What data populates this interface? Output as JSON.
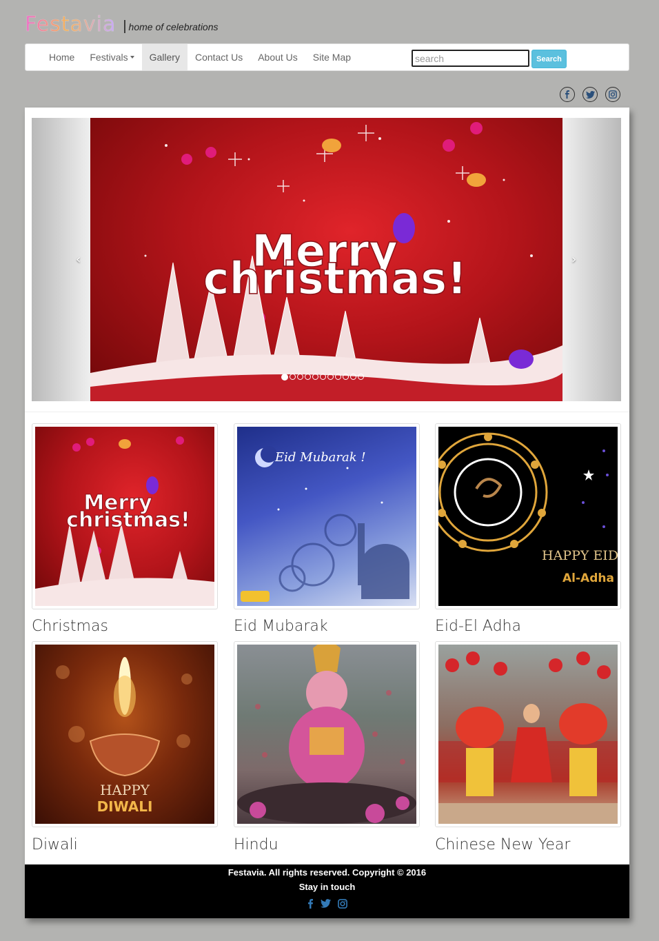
{
  "brand": {
    "logo": "Festavia",
    "separator": "|",
    "tagline": "home of celebrations"
  },
  "nav": {
    "items": [
      {
        "label": "Home"
      },
      {
        "label": "Festivals",
        "has_dropdown": true
      },
      {
        "label": "Gallery",
        "active": true
      },
      {
        "label": "Contact Us"
      },
      {
        "label": "About Us"
      },
      {
        "label": "Site Map"
      }
    ],
    "search_placeholder": "search",
    "search_button": "Search"
  },
  "social": [
    "facebook-icon",
    "twitter-icon",
    "instagram-icon"
  ],
  "carousel": {
    "prev": "‹",
    "next": "›",
    "slide_text_line1": "Merry",
    "slide_text_line2": "christmas!",
    "indicator_count": 11,
    "active_indicator": 0
  },
  "gallery": [
    {
      "caption": "Christmas",
      "art_line1": "Merry",
      "art_line2": "christmas!"
    },
    {
      "caption": "Eid Mubarak",
      "art_line1": "Eid Mubarak !"
    },
    {
      "caption": "Eid-El Adha",
      "art_line1": "HAPPY EID",
      "art_line2": "Al-Adha"
    },
    {
      "caption": "Diwali",
      "art_line1": "HAPPY",
      "art_line2": "DIWALI"
    },
    {
      "caption": "Hindu"
    },
    {
      "caption": "Chinese New Year"
    }
  ],
  "footer": {
    "copyright": "Festavia. All rights reserved. Copyright © 2016",
    "stay": "Stay in touch"
  },
  "colors": {
    "page_bg": "#b3b3b1",
    "search_button": "#5bc0de",
    "footer_bg": "#000000",
    "social_icon": "#337ab7"
  }
}
